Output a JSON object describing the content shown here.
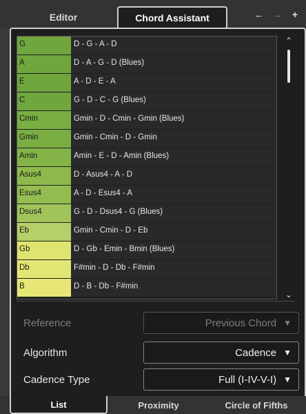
{
  "top_tabs": {
    "editor": "Editor",
    "chord_assistant": "Chord Assistant"
  },
  "header_buttons": {
    "back": "←",
    "forward": "→",
    "add": "+"
  },
  "chord_list": [
    {
      "chord": "G",
      "progression": "D - G - A - D",
      "color": "#6fa63e"
    },
    {
      "chord": "A",
      "progression": "D - A - G - D (Blues)",
      "color": "#6fa63e"
    },
    {
      "chord": "E",
      "progression": "A - D - E - A",
      "color": "#6fa63e"
    },
    {
      "chord": "C",
      "progression": "G - D - C - G (Blues)",
      "color": "#6fa63e"
    },
    {
      "chord": "Cmin",
      "progression": "Gmin - D - Cmin - Gmin (Blues)",
      "color": "#7aae43"
    },
    {
      "chord": "Gmin",
      "progression": "Gmin - Cmin - D - Gmin",
      "color": "#7aae43"
    },
    {
      "chord": "Amin",
      "progression": "Amin - E - D - Amin (Blues)",
      "color": "#84b448"
    },
    {
      "chord": "Asus4",
      "progression": "D - Asus4 - A - D",
      "color": "#8db94c"
    },
    {
      "chord": "Esus4",
      "progression": "A - D - Esus4 - A",
      "color": "#94bd50"
    },
    {
      "chord": "Dsus4",
      "progression": "G - D - Dsus4 - G (Blues)",
      "color": "#a1c45a"
    },
    {
      "chord": "Eb",
      "progression": "Gmin - Cmin - D - Eb",
      "color": "#b6cf68"
    },
    {
      "chord": "Gb",
      "progression": "D - Gb - Emin - Bmin (Blues)",
      "color": "#dfe46f"
    },
    {
      "chord": "Db",
      "progression": "F#min - D - Db - F#min",
      "color": "#e3e672"
    },
    {
      "chord": "B",
      "progression": "D - B - Db - F#min",
      "color": "#e6e776"
    }
  ],
  "options": {
    "reference_label": "Reference",
    "reference_value": "Previous Chord",
    "algorithm_label": "Algorithm",
    "algorithm_value": "Cadence",
    "cadence_type_label": "Cadence Type",
    "cadence_type_value": "Full (I-IV-V-I)",
    "caret": "▼"
  },
  "bottom_tabs": {
    "list": "List",
    "proximity": "Proximity",
    "circle_of_fifths": "Circle of Fifths"
  },
  "scroll": {
    "up": "⌃",
    "down": "⌄"
  }
}
